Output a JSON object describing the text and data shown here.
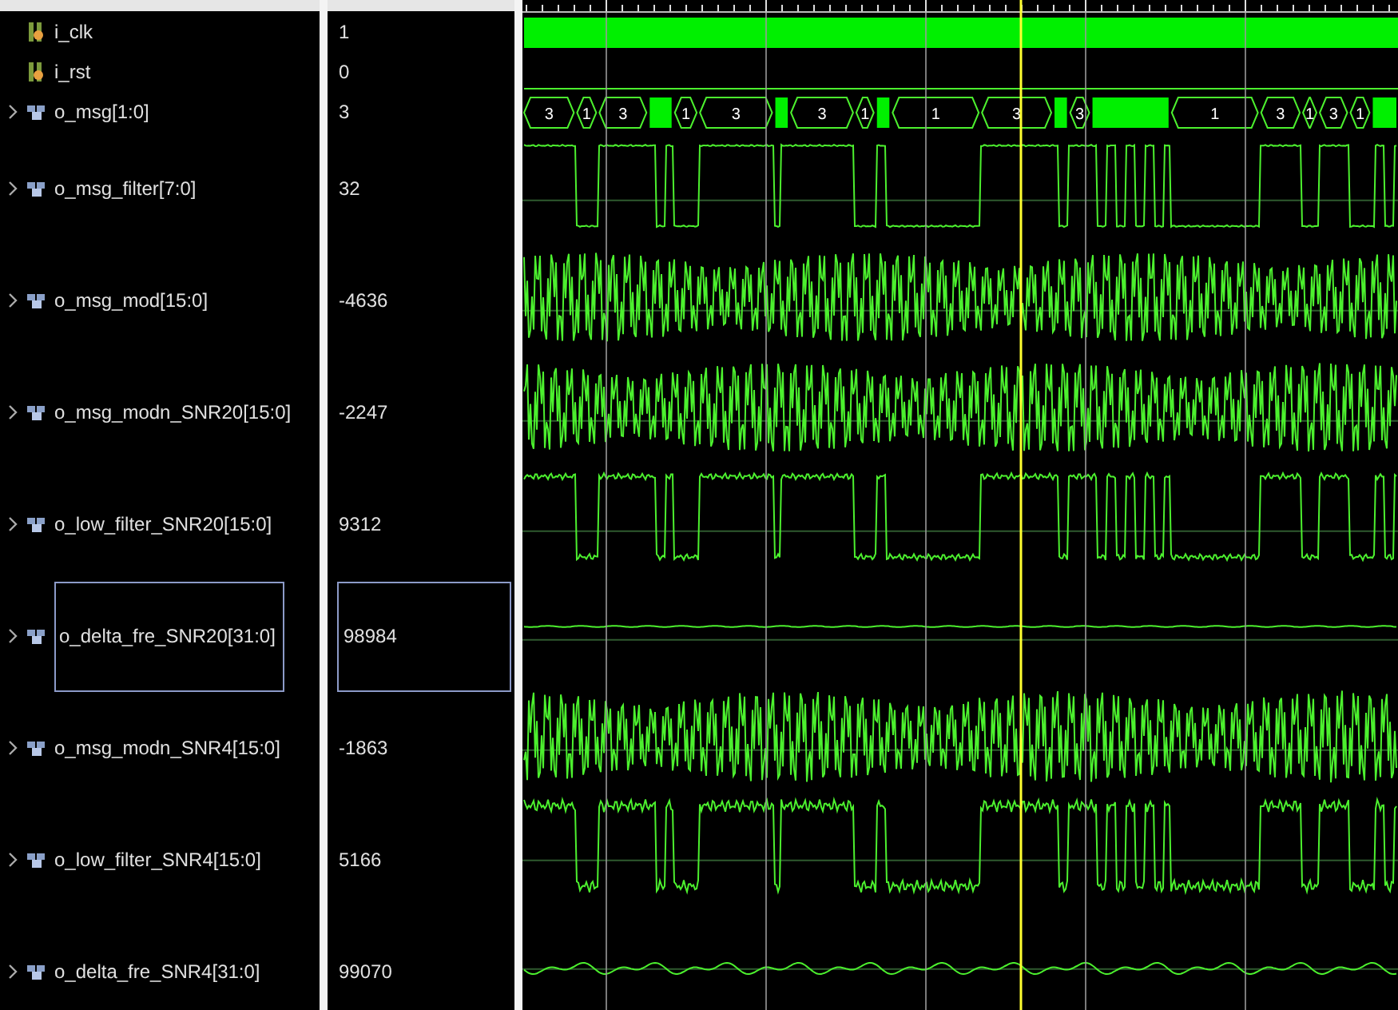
{
  "signals": [
    {
      "name": "i_clk",
      "value": "1",
      "kind": "clock",
      "selected": false
    },
    {
      "name": "i_rst",
      "value": "0",
      "kind": "bit",
      "selected": false
    },
    {
      "name": "o_msg[1:0]",
      "value": "3",
      "kind": "bus",
      "selected": false,
      "segments": [
        {
          "kind": "value",
          "text": "3"
        },
        {
          "kind": "value",
          "text": "1"
        },
        {
          "kind": "value",
          "text": "3"
        },
        {
          "kind": "dense"
        },
        {
          "kind": "value",
          "text": "1"
        },
        {
          "kind": "value",
          "text": "3"
        },
        {
          "kind": "dense"
        },
        {
          "kind": "value",
          "text": "3"
        },
        {
          "kind": "value",
          "text": "1"
        },
        {
          "kind": "dense"
        },
        {
          "kind": "value",
          "text": "1"
        },
        {
          "kind": "value",
          "text": "3"
        },
        {
          "kind": "dense"
        },
        {
          "kind": "value",
          "text": "3"
        },
        {
          "kind": "dense"
        },
        {
          "kind": "value",
          "text": "1"
        },
        {
          "kind": "value",
          "text": "3"
        },
        {
          "kind": "value",
          "text": "1"
        },
        {
          "kind": "value",
          "text": "3"
        },
        {
          "kind": "value",
          "text": "1"
        },
        {
          "kind": "dense"
        }
      ]
    },
    {
      "name": "o_msg_filter[7:0]",
      "value": "32",
      "kind": "pulse",
      "selected": false
    },
    {
      "name": "o_msg_mod[15:0]",
      "value": "-4636",
      "kind": "carrier",
      "selected": false
    },
    {
      "name": "o_msg_modn_SNR20[15:0]",
      "value": "-2247",
      "kind": "carrier",
      "selected": false
    },
    {
      "name": "o_low_filter_SNR20[15:0]",
      "value": "9312",
      "kind": "pulse",
      "selected": false
    },
    {
      "name": "o_delta_fre_SNR20[31:0]",
      "value": "98984",
      "kind": "flat",
      "selected": true
    },
    {
      "name": "o_msg_modn_SNR4[15:0]",
      "value": "-1863",
      "kind": "carrier",
      "selected": false
    },
    {
      "name": "o_low_filter_SNR4[15:0]",
      "value": "5166",
      "kind": "pulse",
      "selected": false
    },
    {
      "name": "o_delta_fre_SNR4[31:0]",
      "value": "99070",
      "kind": "flat",
      "selected": false
    }
  ]
}
